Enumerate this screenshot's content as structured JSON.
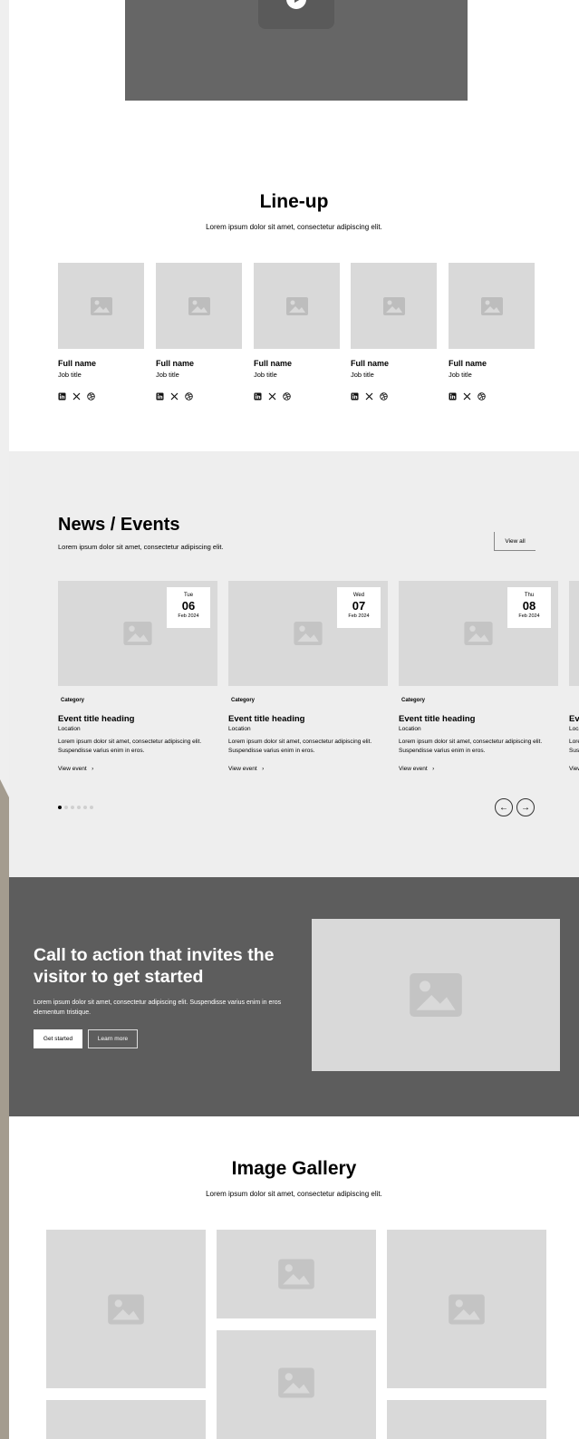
{
  "lineup": {
    "title": "Line-up",
    "subtitle": "Lorem ipsum dolor sit amet, consectetur adipiscing elit.",
    "members": [
      {
        "name": "Full name",
        "job": "Job title"
      },
      {
        "name": "Full name",
        "job": "Job title"
      },
      {
        "name": "Full name",
        "job": "Job title"
      },
      {
        "name": "Full name",
        "job": "Job title"
      },
      {
        "name": "Full name",
        "job": "Job title"
      }
    ],
    "social_icons": [
      "linkedin-icon",
      "x-icon",
      "dribbble-icon"
    ]
  },
  "news": {
    "title": "News / Events",
    "subtitle": "Lorem ipsum dolor sit amet, consectetur adipiscing elit.",
    "view_all": "View all",
    "events": [
      {
        "dow": "Tue",
        "day": "06",
        "month": "Feb 2024",
        "category": "Category",
        "heading": "Event title heading",
        "location": "Location",
        "desc": "Lorem ipsum dolor sit amet, consectetur adipiscing elit. Suspendisse varius enim in eros.",
        "link": "View event"
      },
      {
        "dow": "Wed",
        "day": "07",
        "month": "Feb 2024",
        "category": "Category",
        "heading": "Event title heading",
        "location": "Location",
        "desc": "Lorem ipsum dolor sit amet, consectetur adipiscing elit. Suspendisse varius enim in eros.",
        "link": "View event"
      },
      {
        "dow": "Thu",
        "day": "08",
        "month": "Feb 2024",
        "category": "Category",
        "heading": "Event title heading",
        "location": "Location",
        "desc": "Lorem ipsum dolor sit amet, consectetur adipiscing elit. Suspendisse varius enim in eros.",
        "link": "View event"
      }
    ],
    "pagination_dots": 6,
    "active_dot": 1
  },
  "cta": {
    "title": "Call to action that invites the visitor to get started",
    "text": "Lorem ipsum dolor sit amet, consectetur adipiscing elit. Suspendisse varius enim in eros elementum tristique.",
    "primary": "Get started",
    "secondary": "Learn more"
  },
  "gallery": {
    "title": "Image Gallery",
    "subtitle": "Lorem ipsum dolor sit amet, consectetur adipiscing elit."
  },
  "colors": {
    "placeholder": "#d9d9d9",
    "cta_bg": "#5d5d5d",
    "news_bg": "#eeeeee",
    "video_bg": "#666666"
  }
}
